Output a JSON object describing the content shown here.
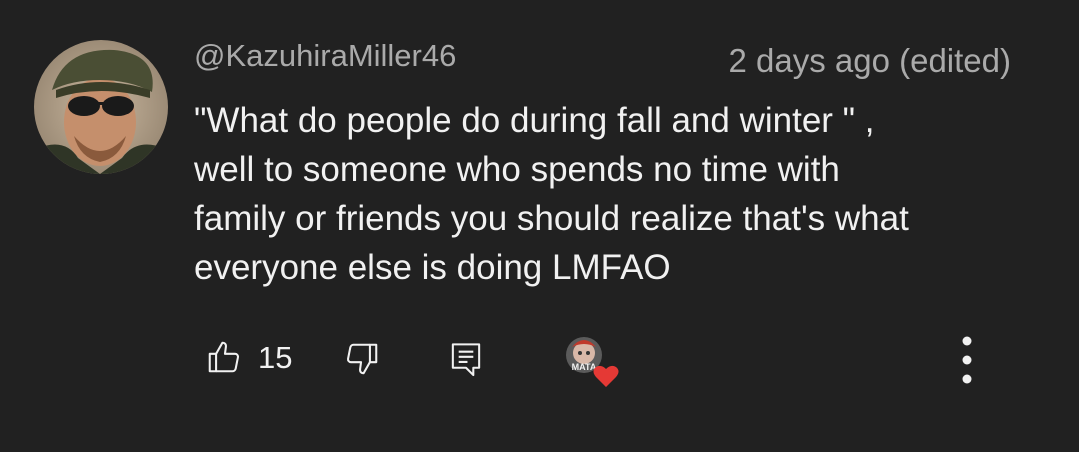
{
  "comment": {
    "author": "@KazuhiraMiller46",
    "timestamp": "2 days ago (edited)",
    "text_lines": [
      "\"What do people do during fall and winter \" ,",
      "well to someone who spends no time with",
      "family or friends you should realize that's what",
      "everyone else is doing LMFAO"
    ]
  },
  "actions": {
    "like_icon": "thumbs-up-icon",
    "like_count": "15",
    "dislike_icon": "thumbs-down-icon",
    "reply_icon": "reply-comment-icon",
    "creator_heart_icon": "creator-heart-icon",
    "creator_avatar_text": "MATA",
    "more_icon": "more-vertical-icon"
  },
  "colors": {
    "background": "#212121",
    "text_primary": "#f1f1f1",
    "text_secondary": "#aaaaaa",
    "heart": "#e53935"
  }
}
